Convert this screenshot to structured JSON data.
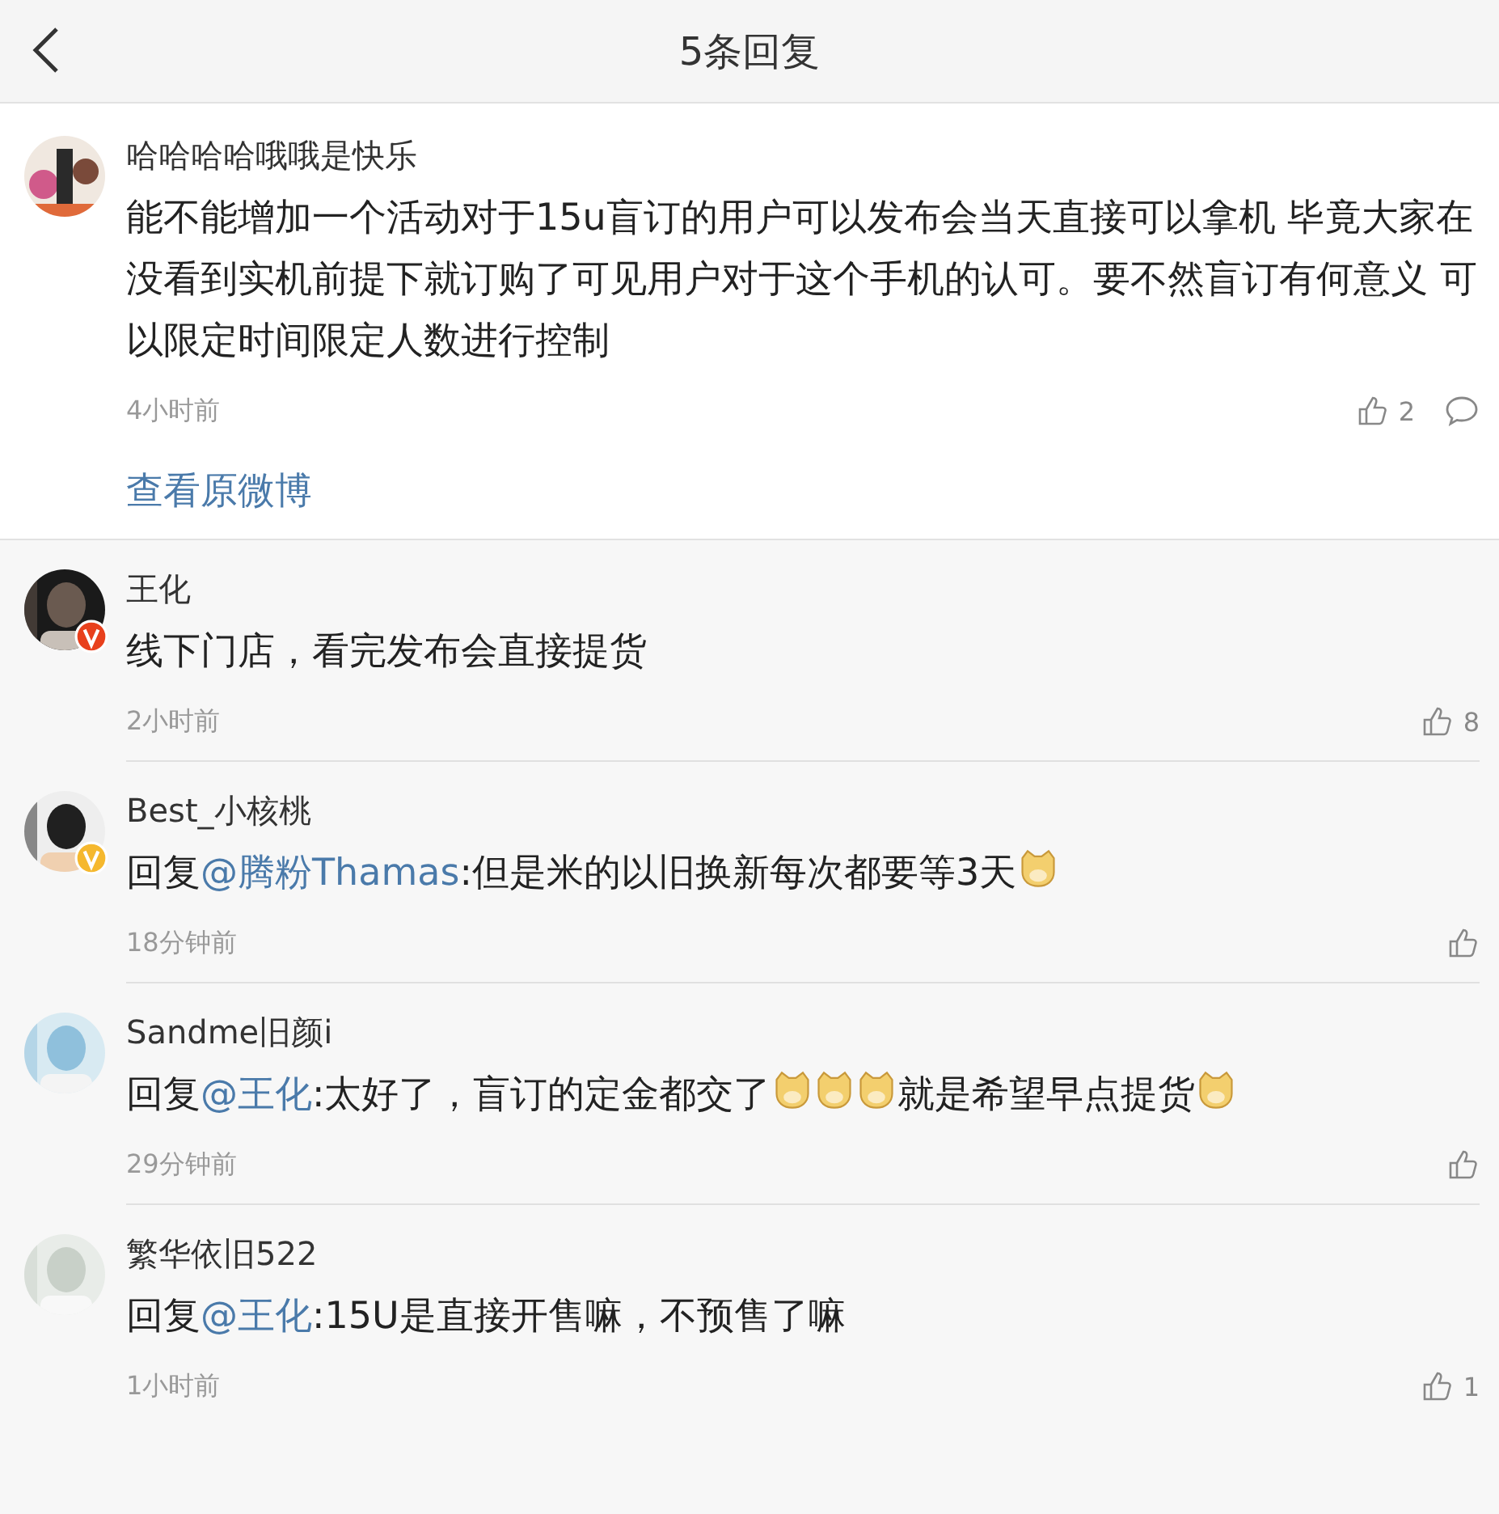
{
  "header": {
    "title": "5条回复"
  },
  "post": {
    "author": "哈哈哈哈哦哦是快乐",
    "text": "能不能增加一个活动对于15u盲订的用户可以发布会当天直接可以拿机 毕竟大家在没看到实机前提下就订购了可见用户对于这个手机的认可。要不然盲订有何意义 可以限定时间限定人数进行控制",
    "time": "4小时前",
    "likes": "2",
    "link": "查看原微博"
  },
  "replies": [
    {
      "author": "王化",
      "color": "#e8401c",
      "segments": [
        {
          "kind": "text",
          "text": "线下门店，看完发布会直接提货"
        }
      ],
      "time": "2小时前",
      "likes": "8"
    },
    {
      "author": "Best_小核桃",
      "color": "#f5b82e",
      "segments": [
        {
          "kind": "text",
          "text": "回复"
        },
        {
          "kind": "mention",
          "text": "@腾粉Thamas"
        },
        {
          "kind": "text",
          "text": ":但是米的以旧换新每次都要等3天"
        },
        {
          "kind": "emoji"
        }
      ],
      "time": "18分钟前"
    },
    {
      "author": "Sandme旧颜i",
      "segments": [
        {
          "kind": "text",
          "text": "回复"
        },
        {
          "kind": "mention",
          "text": "@王化"
        },
        {
          "kind": "text",
          "text": ":太好了，盲订的定金都交了"
        },
        {
          "kind": "emoji"
        },
        {
          "kind": "emoji"
        },
        {
          "kind": "emoji"
        },
        {
          "kind": "text",
          "text": "就是希望早点提货"
        },
        {
          "kind": "emoji"
        }
      ],
      "time": "29分钟前"
    },
    {
      "author": "繁华依旧522",
      "segments": [
        {
          "kind": "text",
          "text": "回复"
        },
        {
          "kind": "mention",
          "text": "@王化"
        },
        {
          "kind": "text",
          "text": ":15U是直接开售嘛，不预售了嘛"
        }
      ],
      "time": "1小时前",
      "likes": "1"
    }
  ]
}
